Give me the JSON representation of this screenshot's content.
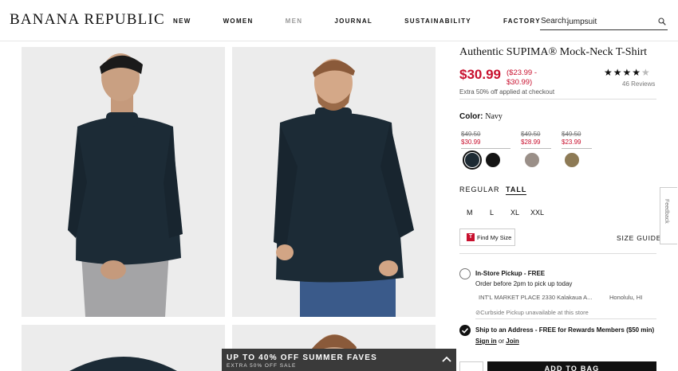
{
  "header": {
    "logo": "BANANA REPUBLIC",
    "nav": [
      "NEW",
      "WOMEN",
      "MEN",
      "JOURNAL",
      "SUSTAINABILITY",
      "FACTORY"
    ],
    "search_label": "Search:",
    "search_value": "jumpsuit"
  },
  "product": {
    "title": "Authentic SUPIMA® Mock-Neck T-Shirt",
    "price": "$30.99",
    "price_range": "($23.99 - $30.99)",
    "rating_stars": 4.5,
    "reviews": "46 Reviews",
    "extra_offer": "Extra 50% off applied at checkout",
    "color_label": "Color:",
    "color_value": "Navy",
    "price_groups": [
      {
        "old": "$49.50",
        "new": "$30.99"
      },
      {
        "old": "$49.50",
        "new": "$28.99"
      },
      {
        "old": "$49.50",
        "new": "$23.99"
      }
    ],
    "swatch_colors": [
      "#1d2a33",
      "#141414",
      "#9a8f88",
      "#8d7a55"
    ],
    "fits": [
      "REGULAR",
      "TALL"
    ],
    "sizes": [
      "M",
      "L",
      "XL",
      "XXL"
    ],
    "find_my_size": "Find My Size",
    "size_guide": "SIZE GUIDE"
  },
  "fulfillment": {
    "pickup_title": "In-Store Pickup - FREE",
    "pickup_sub": "Order before 2pm to pick up today",
    "store": "INT'L MARKET PLACE 2330 Kalakaua A...",
    "city": "Honolulu, HI",
    "curbside": "Curbside Pickup unavailable at this store",
    "ship_title": "Ship to an Address - FREE for Rewards Members ($50 min)",
    "sign_in": "Sign in",
    "or": "or",
    "join": "Join"
  },
  "cta": {
    "add_to_bag": "ADD TO BAG"
  },
  "promo": {
    "title": "UP TO 40% OFF SUMMER FAVES",
    "subtitle": "EXTRA 50% OFF SALE"
  },
  "feedback_tab": "Feedback",
  "colors": {
    "sale_red": "#c8102e",
    "shirt_navy": "#1c2b36",
    "image_bg": "#ececec"
  }
}
